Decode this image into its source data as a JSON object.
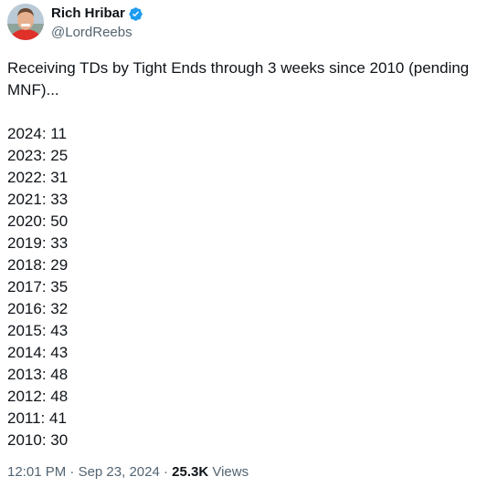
{
  "author": {
    "display_name": "Rich Hribar",
    "handle": "@LordReebs",
    "verified": true,
    "verified_color": "#1d9bf0"
  },
  "tweet": {
    "intro": "Receiving TDs by Tight Ends through 3 weeks since 2010 (pending MNF)...",
    "stats": [
      "2024: 11",
      "2023: 25",
      "2022: 31",
      "2021: 33",
      "2020: 50",
      "2019: 33",
      "2018: 29",
      "2017: 35",
      "2016: 32",
      "2015: 43",
      "2014: 43",
      "2013: 48",
      "2012: 48",
      "2011: 41",
      "2010: 30"
    ]
  },
  "meta": {
    "time": "12:01 PM",
    "separator": "·",
    "date": "Sep 23, 2024",
    "views_count": "25.3K",
    "views_label": "Views"
  },
  "colors": {
    "text": "#0f1419",
    "secondary": "#536471",
    "avatar_shirt": "#e0302a"
  },
  "icons": {
    "verified": "verified-badge-icon",
    "avatar": "avatar-image"
  }
}
